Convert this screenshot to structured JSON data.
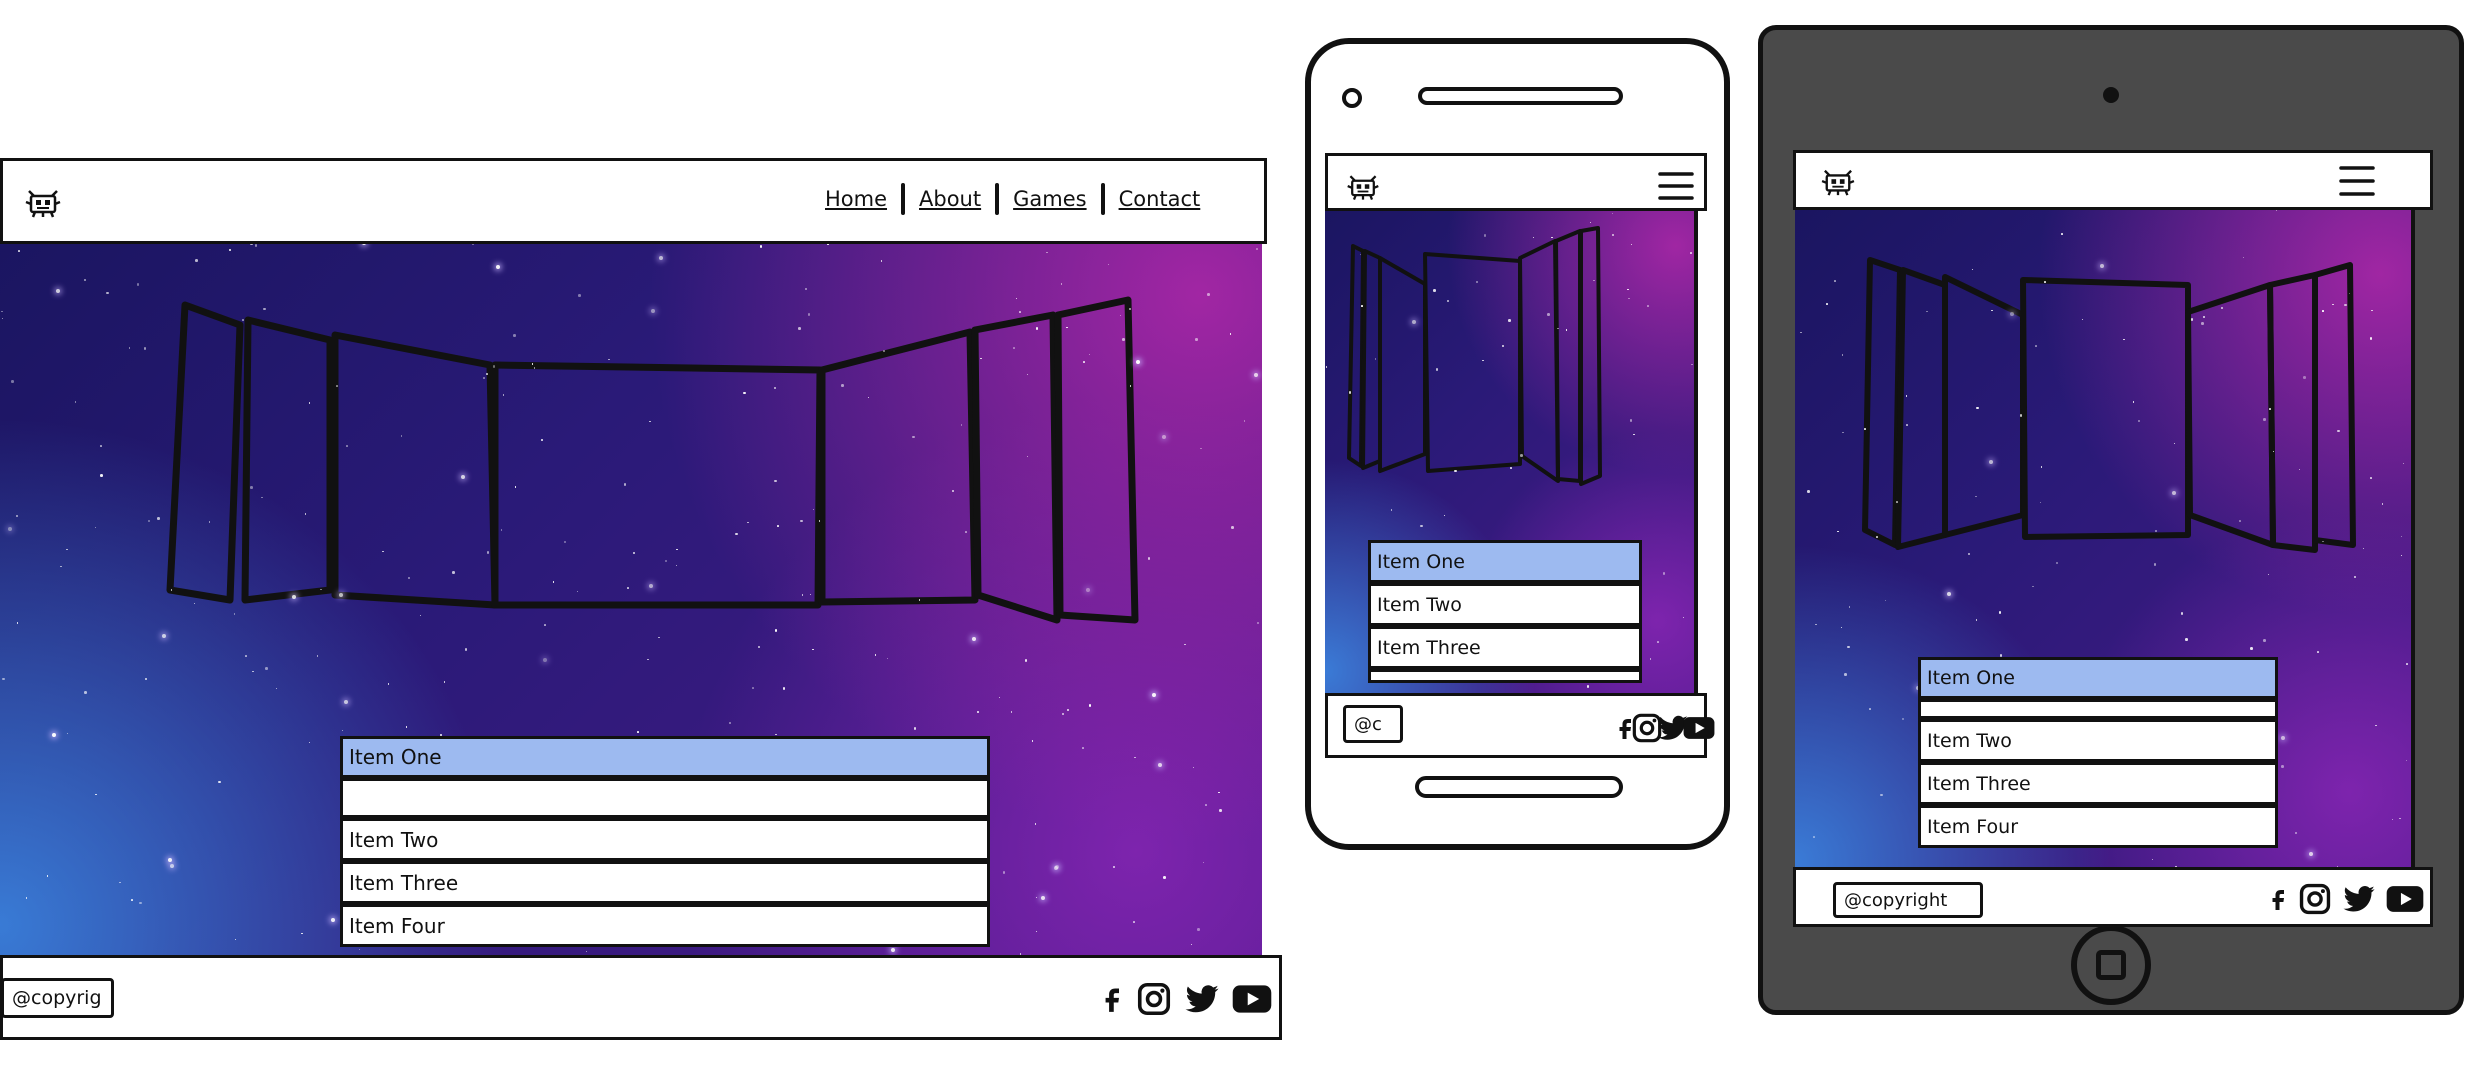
{
  "desktop": {
    "nav": [
      {
        "label": "Home"
      },
      {
        "label": "About"
      },
      {
        "label": "Games"
      },
      {
        "label": "Contact"
      }
    ],
    "list": [
      "Item One",
      "",
      "Item Two",
      "Item Three",
      "Item Four"
    ],
    "copyright": "@copyrig"
  },
  "phone": {
    "list": [
      "Item One",
      "Item Two",
      "Item Three",
      ""
    ],
    "copyright": "@c"
  },
  "tablet": {
    "list": [
      "Item One",
      "",
      "Item Two",
      "Item Three",
      "Item Four"
    ],
    "copyright": "@copyright"
  },
  "icons": [
    "logo-robot-icon",
    "hamburger-menu-icon",
    "facebook-icon",
    "instagram-icon",
    "twitter-icon",
    "youtube-icon"
  ],
  "colors": {
    "selected_item": "#9dbaf0",
    "space_dark": "#1a1560",
    "space_purple": "#4a1a8a",
    "tablet_frame": "#4a4a4a"
  }
}
